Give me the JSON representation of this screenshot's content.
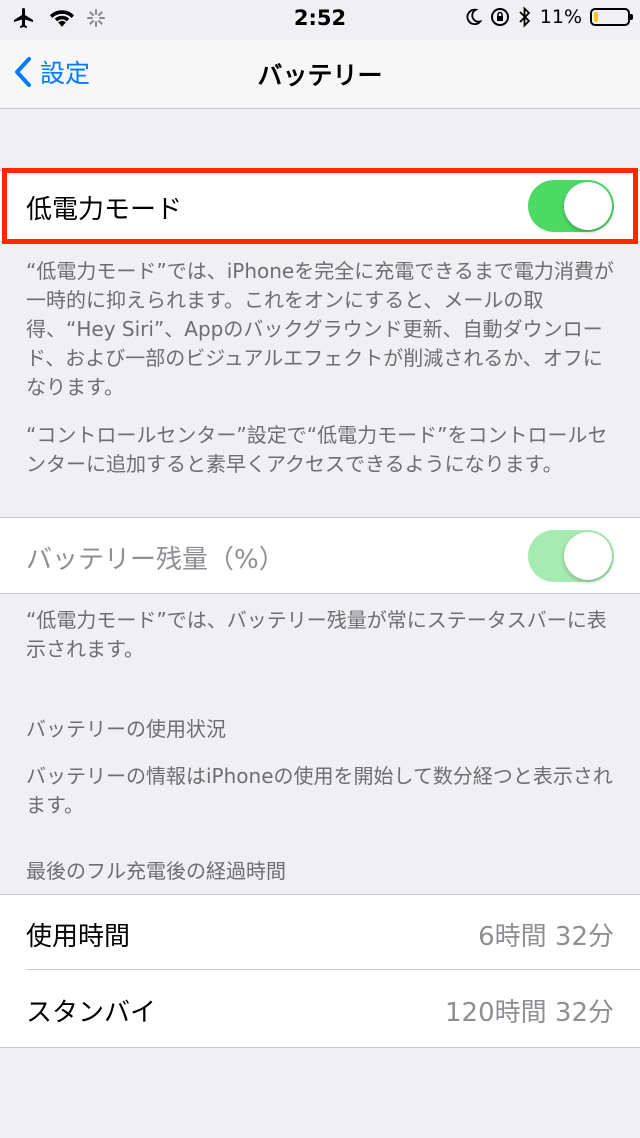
{
  "status_bar": {
    "time": "2:52",
    "battery_percent": "11%",
    "battery_level": 0.11,
    "icons": [
      "airplane-icon",
      "wifi-icon",
      "loading-icon",
      "moon-icon",
      "orientation-lock-icon",
      "bluetooth-icon"
    ]
  },
  "nav": {
    "back_label": "設定",
    "title": "バッテリー"
  },
  "low_power": {
    "label": "低電力モード",
    "enabled": true,
    "note1": "“低電力モード”では、iPhoneを完全に充電できるまで電力消費が一時的に抑えられます。これをオンにすると、メールの取得、“Hey Siri”、Appのバックグラウンド更新、自動ダウンロード、および一部のビジュアルエフェクトが削減されるか、オフになります。",
    "note2": "“コントロールセンター”設定で“低電力モード”をコントロールセンターに追加すると素早くアクセスできるようになります。"
  },
  "battery_percentage": {
    "label": "バッテリー残量（%）",
    "enabled": true,
    "disabled": true,
    "note": "“低電力モード”では、バッテリー残量が常にステータスバーに表示されます。"
  },
  "usage": {
    "header": "バッテリーの使用状況",
    "note": "バッテリーの情報はiPhoneの使用を開始して数分経つと表示されます。"
  },
  "since_charge": {
    "header": "最後のフル充電後の経過時間",
    "rows": [
      {
        "label": "使用時間",
        "value": "6時間 32分"
      },
      {
        "label": "スタンバイ",
        "value": "120時間 32分"
      }
    ]
  },
  "colors": {
    "accent": "#007aff",
    "toggle_on": "#4cd964",
    "toggle_disabled": "#a6ebb1",
    "highlight": "#ff2600",
    "battery_fill": "#f5c518"
  }
}
